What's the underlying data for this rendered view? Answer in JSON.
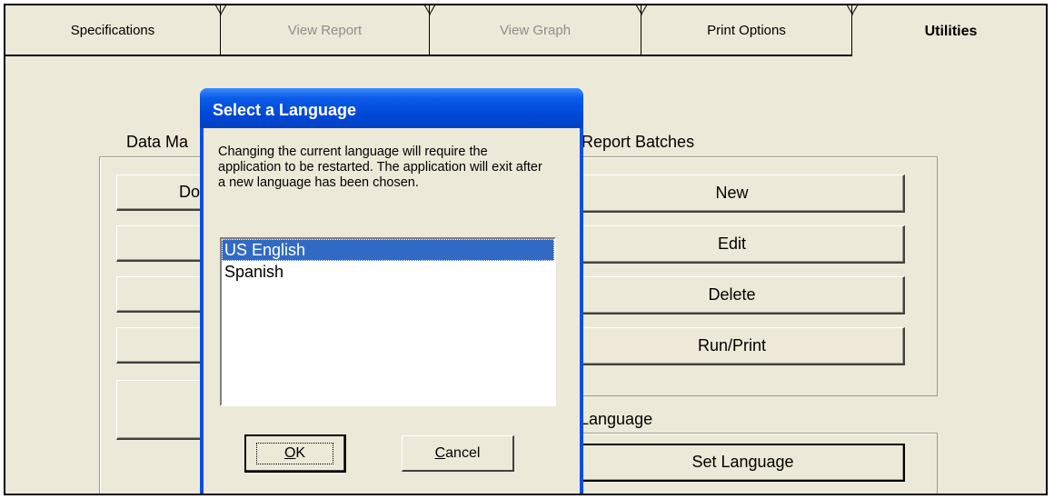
{
  "tabs": [
    {
      "label": "Specifications",
      "state": "normal"
    },
    {
      "label": "View Report",
      "state": "disabled"
    },
    {
      "label": "View Graph",
      "state": "disabled"
    },
    {
      "label": "Print Options",
      "state": "normal"
    },
    {
      "label": "Utilities",
      "state": "active"
    }
  ],
  "data_management": {
    "label": "Data Ma",
    "first_button_label": "Do"
  },
  "report_batches": {
    "label": "Report Batches",
    "buttons": [
      "New",
      "Edit",
      "Delete",
      "Run/Print"
    ]
  },
  "language_group": {
    "label": "Language",
    "set_language_label": "Set Language"
  },
  "dialog": {
    "title": "Select a Language",
    "message": "Changing the current language will require the application to be restarted.  The application will exit after a new language has been chosen.",
    "languages": [
      "US English",
      "Spanish"
    ],
    "selected": "US English",
    "ok_mnemonic": "O",
    "ok_rest": "K",
    "cancel_mnemonic": "C",
    "cancel_rest": "ancel"
  },
  "colors": {
    "window_bg": "#ece9d8",
    "title_blue": "#0047d5",
    "selection": "#316ac5",
    "disabled_text": "#8e8e8e"
  }
}
